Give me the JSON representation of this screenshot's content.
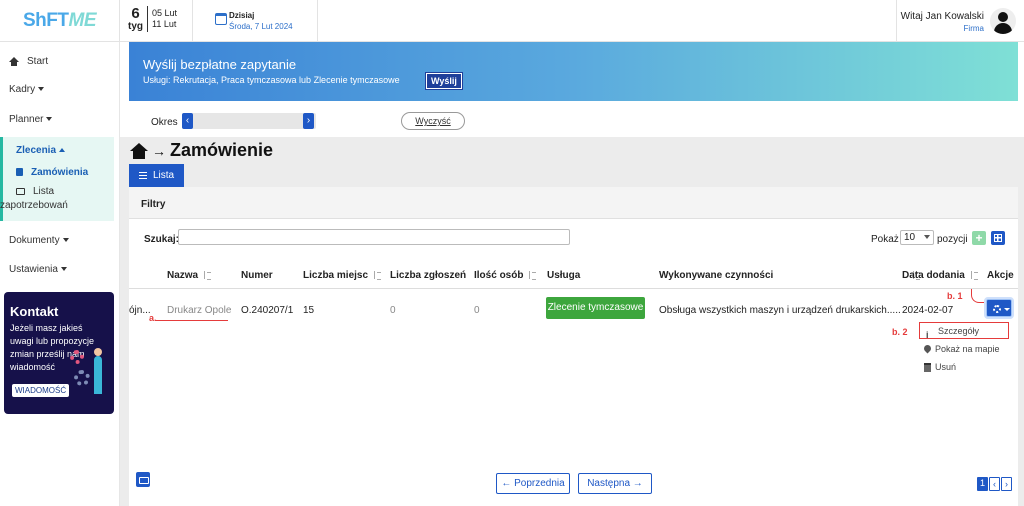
{
  "header": {
    "logo_text": "ShFT",
    "logo_accent": "ME",
    "week_number": "6",
    "week_label": "tyg",
    "week_range_start": "05 Lut",
    "week_range_end": "11 Lut",
    "today_label": "Dzisiaj",
    "today_date": "Środa, 7 Lut 2024",
    "user_greeting": "Witaj Jan Kowalski",
    "user_role": "Firma"
  },
  "sidebar": {
    "start": "Start",
    "kadry": "Kadry",
    "planner": "Planner",
    "zlecenia": "Zlecenia",
    "zamowienia": "Zamówienia",
    "lista_line1": "Lista",
    "lista_line2": "zapotrzebowań",
    "dokumenty": "Dokumenty",
    "ustawienia": "Ustawienia",
    "contact": {
      "title": "Kontakt",
      "description": "Jeżeli masz jakieś uwagi lub propozycje zmian prześlij nam wiadomość",
      "button": "WIADOMOŚĆ"
    }
  },
  "banner": {
    "title": "Wyślij bezpłatne zapytanie",
    "subtitle": "Usługi: Rekrutacja, Praca tymczasowa lub Zlecenie tymczasowe",
    "button": "Wyślij"
  },
  "period": {
    "label": "Okres",
    "clear_button": "Wyczyść"
  },
  "page": {
    "title": "Zamówienie",
    "tab_list": "Lista",
    "filters_title": "Filtry",
    "search_label": "Szukaj:",
    "search_value": "",
    "show_label": "Pokaż",
    "show_value": "10",
    "positions_label": "pozycji"
  },
  "table": {
    "columns": [
      "Nazwa",
      "Numer",
      "Liczba miejsc",
      "Liczba zgłoszeń",
      "Ilość osób",
      "Usługa",
      "Wykonywane czynności",
      "Data dodania",
      "Akcje"
    ],
    "row": {
      "cut_prefix": "ójn...",
      "nazwa": "Drukarz Opole",
      "numer": "O.240207/1",
      "liczba_miejsc": "15",
      "liczba_zgloszen": "0",
      "ilosc_osob": "0",
      "usluga": "Zlecenie tymczasowe",
      "czynnosci": "Obsługa wszystkich maszyn i urządzeń drukarskich.....",
      "data": "2024-02-07"
    }
  },
  "annotations": {
    "a": "a.",
    "b1": "b. 1",
    "b2": "b. 2"
  },
  "actions_menu": {
    "details": "Szczegóły",
    "map": "Pokaż na mapie",
    "delete": "Usuń"
  },
  "pagination": {
    "prev": "Poprzednia",
    "next": "Następna",
    "current_page": "1"
  },
  "colors": {
    "primary": "#1f58c6",
    "accent_teal": "#26b8a2",
    "annotation_red": "#e53b3b",
    "service_green": "#3da63d"
  }
}
